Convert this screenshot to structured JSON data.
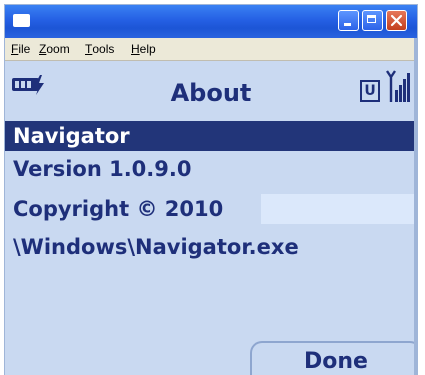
{
  "menu": {
    "items": [
      {
        "mnemonic": "F",
        "rest": "ile"
      },
      {
        "mnemonic": "Z",
        "rest": "oom"
      },
      {
        "mnemonic": "T",
        "rest": "ools"
      },
      {
        "mnemonic": "H",
        "rest": "elp"
      }
    ]
  },
  "status": {
    "title": "About",
    "network_indicator": "U",
    "icons": [
      "battery-charging-icon",
      "signal-strength-icon"
    ]
  },
  "about": {
    "rows": [
      "Navigator",
      "Version 1.0.9.0",
      "Copyright © 2010",
      "\\Windows\\Navigator.exe"
    ],
    "selected_index": 0
  },
  "softkey": {
    "label": "Done"
  },
  "colors": {
    "accent": "#1e2f7a",
    "background": "#c9d9f1",
    "selection": "#223579"
  }
}
